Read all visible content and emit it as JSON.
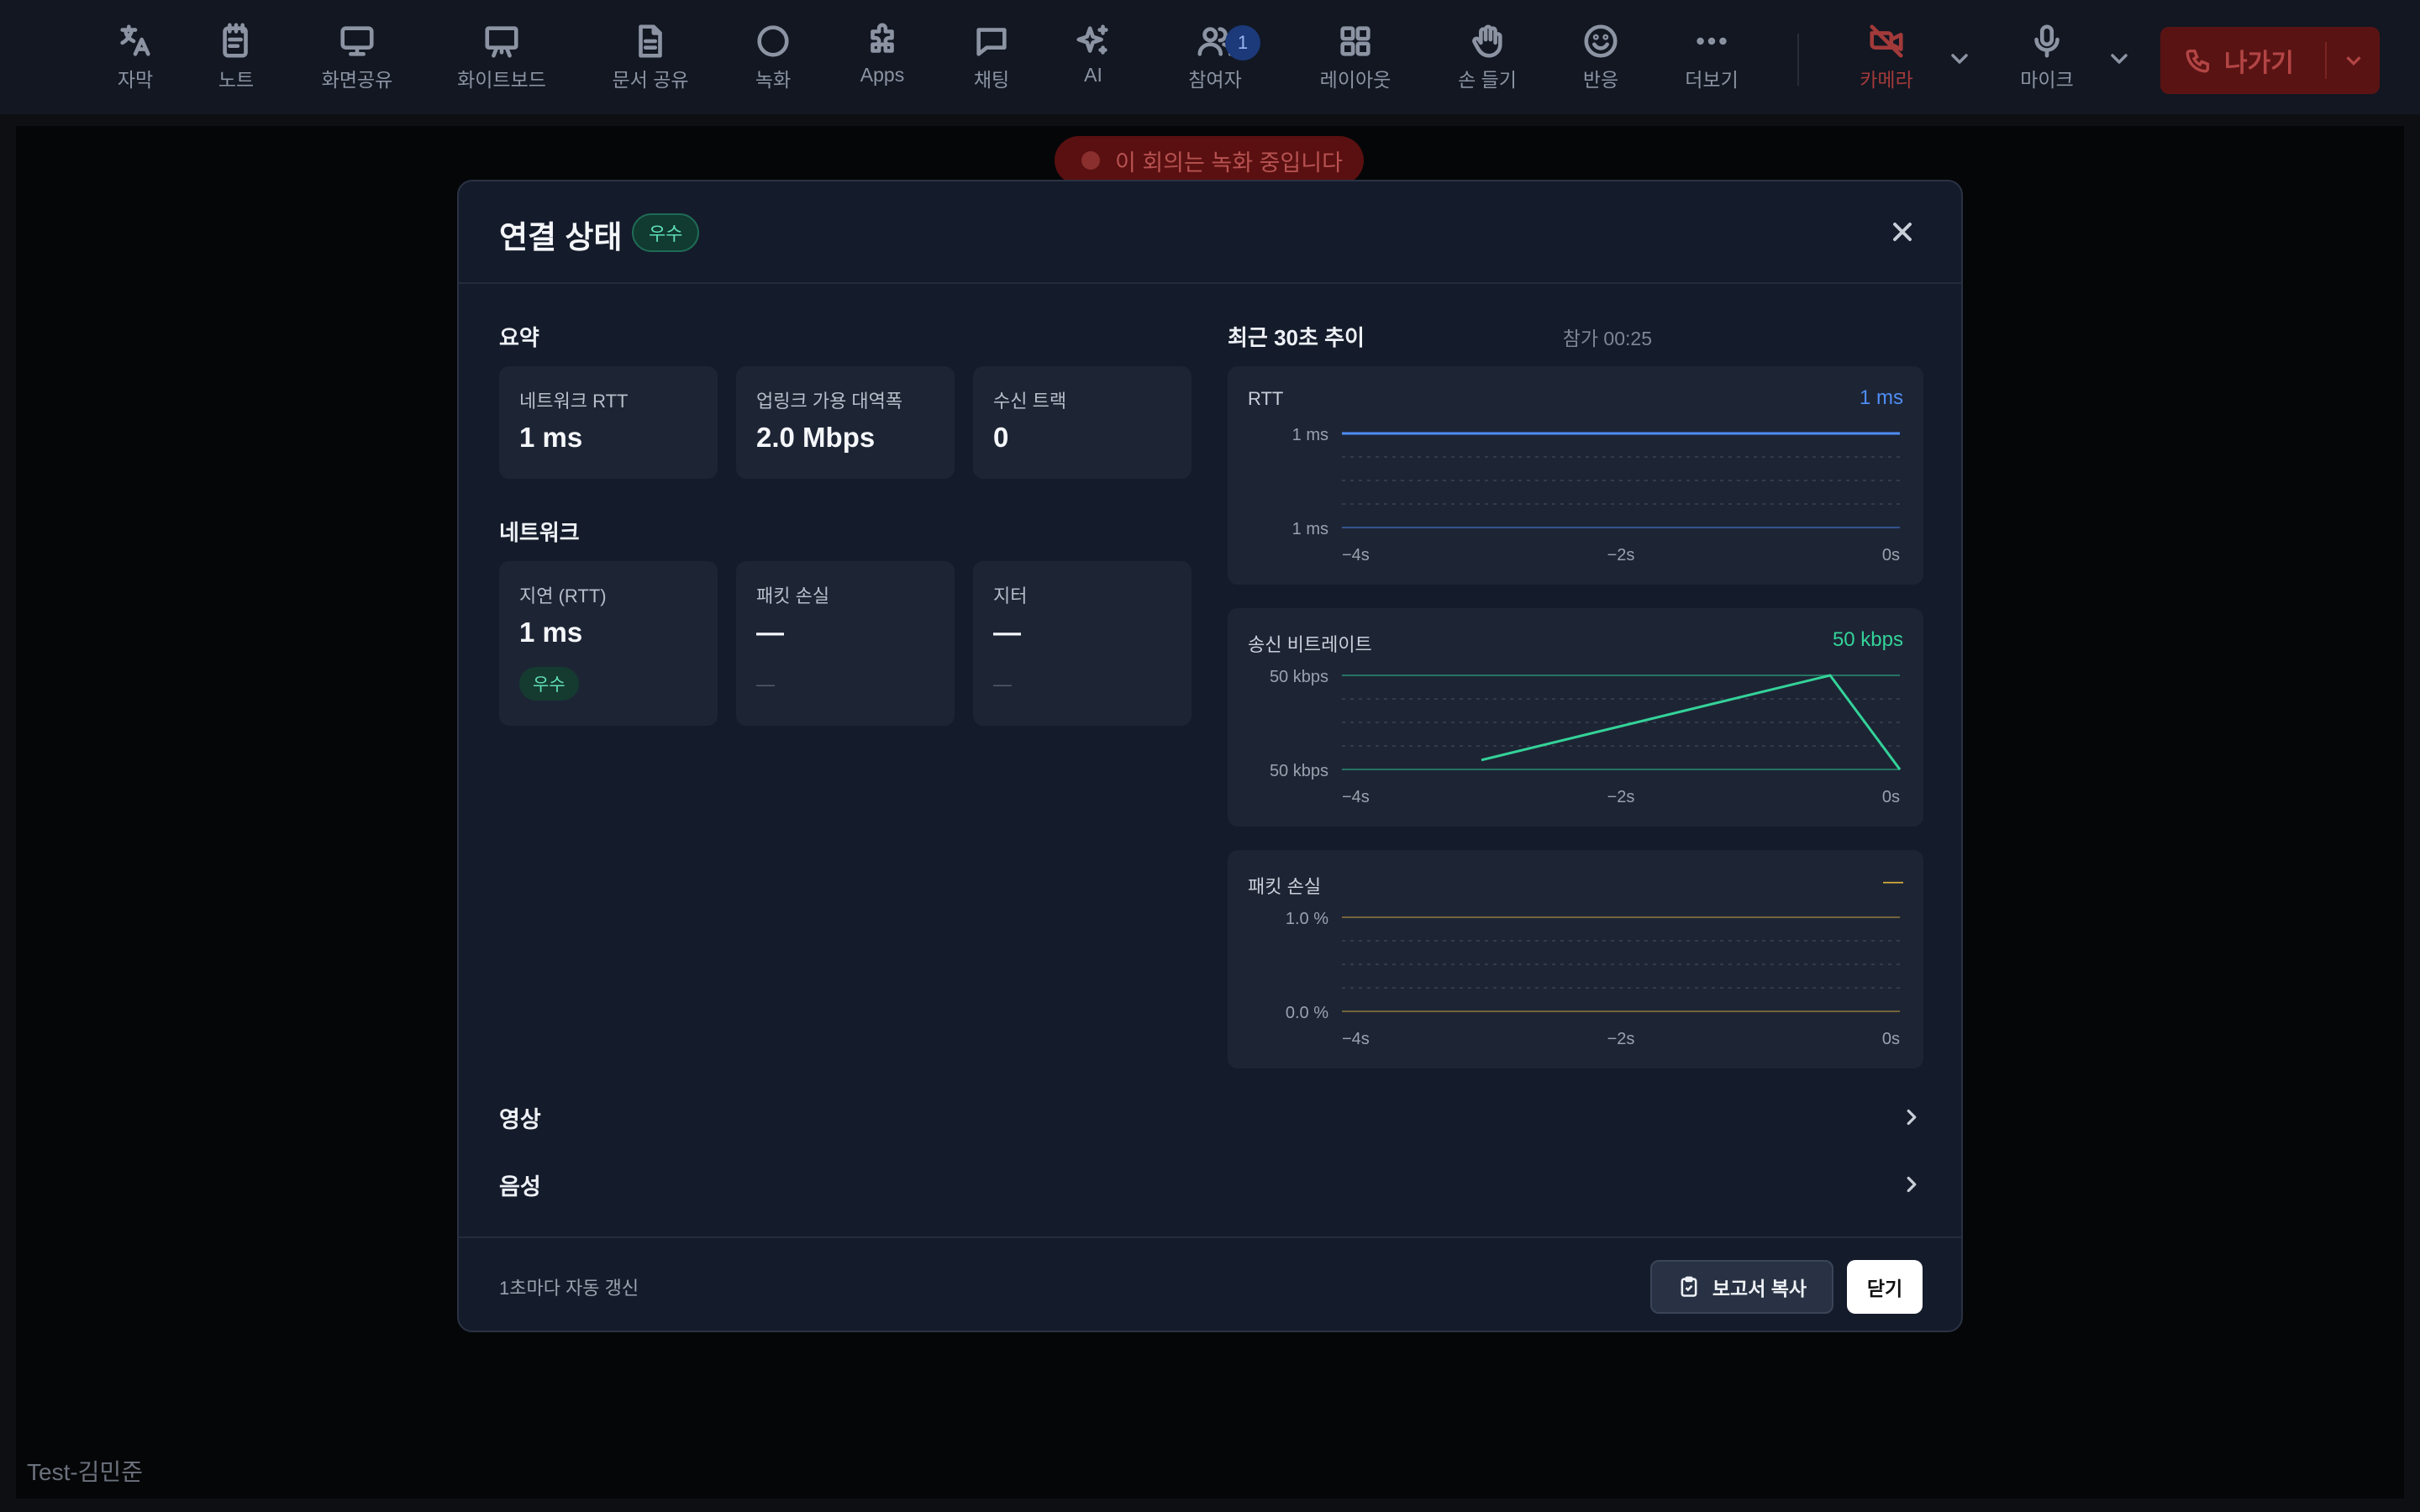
{
  "toolbar": {
    "items": [
      {
        "label": "자막",
        "icon": "translate-icon"
      },
      {
        "label": "노트",
        "icon": "notes-icon"
      },
      {
        "label": "화면공유",
        "icon": "monitor-icon"
      },
      {
        "label": "화이트보드",
        "icon": "whiteboard-icon"
      },
      {
        "label": "문서 공유",
        "icon": "document-icon"
      },
      {
        "label": "녹화",
        "icon": "record-icon"
      },
      {
        "label": "Apps",
        "icon": "puzzle-icon"
      },
      {
        "label": "채팅",
        "icon": "chat-icon"
      },
      {
        "label": "AI",
        "icon": "sparkles-icon"
      },
      {
        "label": "참여자",
        "icon": "users-icon",
        "badge": "1"
      },
      {
        "label": "레이아웃",
        "icon": "grid-icon"
      },
      {
        "label": "손 들기",
        "icon": "hand-icon"
      },
      {
        "label": "반응",
        "icon": "smile-icon"
      },
      {
        "label": "더보기",
        "icon": "more-icon"
      }
    ],
    "camera_label": "카메라",
    "mic_label": "마이크",
    "leave_label": "나가기"
  },
  "recording_banner": "이 회의는 녹화 중입니다",
  "user_name": "Test-김민준",
  "modal": {
    "title": "연결 상태",
    "status": "우수",
    "summary": {
      "title": "요약",
      "join_time": "참가 00:25",
      "cards": [
        {
          "label": "네트워크 RTT",
          "value": "1 ms"
        },
        {
          "label": "업링크 가용 대역폭",
          "value": "2.0 Mbps"
        },
        {
          "label": "수신 트랙",
          "value": "0"
        }
      ]
    },
    "network": {
      "title": "네트워크",
      "cards": [
        {
          "label": "지연 (RTT)",
          "value": "1 ms",
          "badge": "우수"
        },
        {
          "label": "패킷 손실",
          "value": "—",
          "sub": "—"
        },
        {
          "label": "지터",
          "value": "—",
          "sub": "—"
        }
      ]
    },
    "trend_title": "최근 30초 추이",
    "sections": [
      {
        "label": "영상"
      },
      {
        "label": "음성"
      }
    ],
    "footer": {
      "auto_refresh": "1초마다 자동 갱신",
      "copy_label": "보고서 복사",
      "close_label": "닫기"
    }
  },
  "chart_data": [
    {
      "type": "line",
      "title": "RTT",
      "current": "1 ms",
      "color": "#4f8ef7",
      "x": [
        -4,
        -3,
        -2,
        -1,
        0
      ],
      "y": [
        1,
        1,
        1,
        1,
        1
      ],
      "y_tick_labels": [
        "1 ms",
        "1 ms"
      ],
      "x_tick_labels": [
        "−4s",
        "−2s",
        "0s"
      ]
    },
    {
      "type": "line",
      "title": "송신 비트레이트",
      "current": "50 kbps",
      "color": "#34d399",
      "x": [
        -3,
        -0.5,
        0
      ],
      "y": [
        0.1,
        1.0,
        0.0
      ],
      "y_tick_labels": [
        "50 kbps",
        "50 kbps"
      ],
      "x_tick_labels": [
        "−4s",
        "−2s",
        "0s"
      ]
    },
    {
      "type": "line",
      "title": "패킷 손실",
      "current": "—",
      "color": "#e0b43a",
      "x": [],
      "y": [],
      "y_tick_labels": [
        "1.0 %",
        "0.0 %"
      ],
      "x_tick_labels": [
        "−4s",
        "−2s",
        "0s"
      ]
    }
  ]
}
